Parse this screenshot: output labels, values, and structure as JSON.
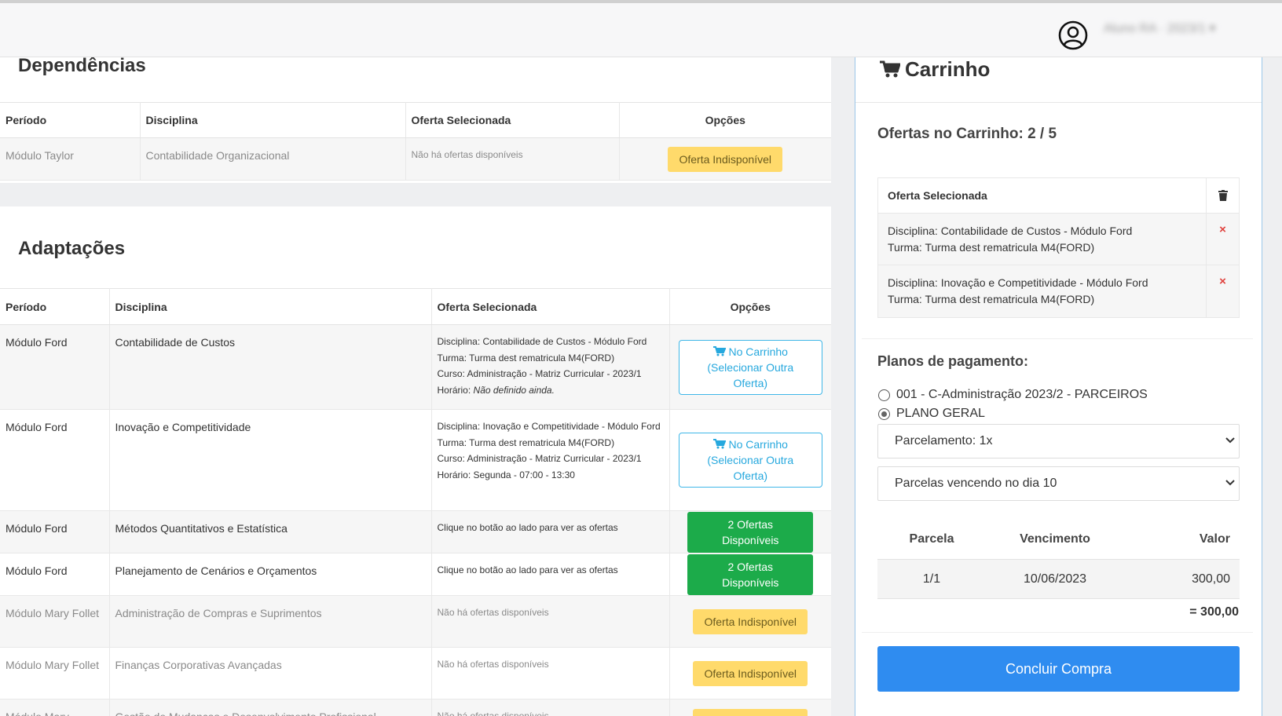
{
  "header": {
    "user_name": "Aluno RA · 2023/1 ▾",
    "avatar_icon": "user-circle-icon"
  },
  "dependencias": {
    "title": "Dependências",
    "columns": [
      "Período",
      "Disciplina",
      "Oferta Selecionada",
      "Opções"
    ],
    "rows": [
      {
        "periodo": "Módulo Taylor",
        "disciplina": "Contabilidade Organizacional",
        "oferta": "Não há ofertas disponíveis",
        "opcao": "Oferta Indisponível"
      }
    ]
  },
  "adaptacoes": {
    "title": "Adaptações",
    "columns": [
      "Período",
      "Disciplina",
      "Oferta Selecionada",
      "Opções"
    ],
    "rows": [
      {
        "periodo": "Módulo Ford",
        "disciplina": "Contabilidade de Custos",
        "oferta_lines": [
          "Disciplina: Contabilidade de Custos - Módulo Ford",
          "Turma: Turma dest rematricula M4(FORD)",
          "Curso: Administração - Matriz Curricular - 2023/1"
        ],
        "horario_label": "Horário:",
        "horario_value": "Não definido ainda.",
        "opcao_line1": "No Carrinho",
        "opcao_line2": "(Selecionar Outra Oferta)"
      },
      {
        "periodo": "Módulo Ford",
        "disciplina": "Inovação e Competitividade",
        "oferta_lines": [
          "Disciplina: Inovação e Competitividade - Módulo Ford",
          "Turma: Turma dest rematricula M4(FORD)",
          "Curso: Administração - Matriz Curricular - 2023/1"
        ],
        "horario_label": "Horário:",
        "horario_value": "Segunda - 07:00 - 13:30",
        "opcao_line1": "No Carrinho",
        "opcao_line2": "(Selecionar Outra Oferta)"
      },
      {
        "periodo": "Módulo Ford",
        "disciplina": "Métodos Quantitativos e Estatística",
        "oferta": "Clique no botão ao lado para ver as ofertas",
        "opcao": "2 Ofertas Disponíveis"
      },
      {
        "periodo": "Módulo Ford",
        "disciplina": "Planejamento de Cenários e Orçamentos",
        "oferta": "Clique no botão ao lado para ver as ofertas",
        "opcao": "2 Ofertas Disponíveis"
      },
      {
        "periodo": "Módulo Mary Follet",
        "disciplina": "Administração de Compras e Suprimentos",
        "oferta": "Não há ofertas disponíveis",
        "opcao": "Oferta Indisponível"
      },
      {
        "periodo": "Módulo Mary Follet",
        "disciplina": "Finanças Corporativas Avançadas",
        "oferta": "Não há ofertas disponíveis",
        "opcao": "Oferta Indisponível"
      },
      {
        "periodo": "Módulo Mary",
        "disciplina": "Gestão de Mudanças e Desenvolvimento Profissional",
        "oferta": "Não há ofertas disponíveis",
        "opcao": "Oferta Indisponível"
      }
    ]
  },
  "cart": {
    "title": "Carrinho",
    "count_text": "Ofertas no Carrinho: 2 / 5",
    "table_header": "Oferta Selecionada",
    "items": [
      {
        "line1": "Disciplina: Contabilidade de Custos - Módulo Ford",
        "line2": "Turma: Turma dest rematricula M4(FORD)",
        "remove": "×"
      },
      {
        "line1": "Disciplina: Inovação e Competitividade - Módulo Ford",
        "line2": "Turma: Turma dest rematricula M4(FORD)",
        "remove": "×"
      }
    ]
  },
  "payment": {
    "title": "Planos de pagamento:",
    "plans": [
      {
        "label": "001 - C-Administração 2023/2 - PARCEIROS",
        "checked": false
      },
      {
        "label": "PLANO GERAL",
        "checked": true
      }
    ],
    "parcelamento": "Parcelamento: 1x",
    "vencimento": "Parcelas vencendo no dia 10",
    "columns": [
      "Parcela",
      "Vencimento",
      "Valor"
    ],
    "rows": [
      {
        "parcela": "1/1",
        "vencimento": "10/06/2023",
        "valor": "300,00"
      }
    ],
    "total": "= 300,00",
    "submit": "Concluir Compra"
  },
  "colors": {
    "primary": "#2f8cf0",
    "success": "#1cab4a",
    "warning": "#ffda6b",
    "info": "#26a8de",
    "danger": "#e0403c"
  }
}
